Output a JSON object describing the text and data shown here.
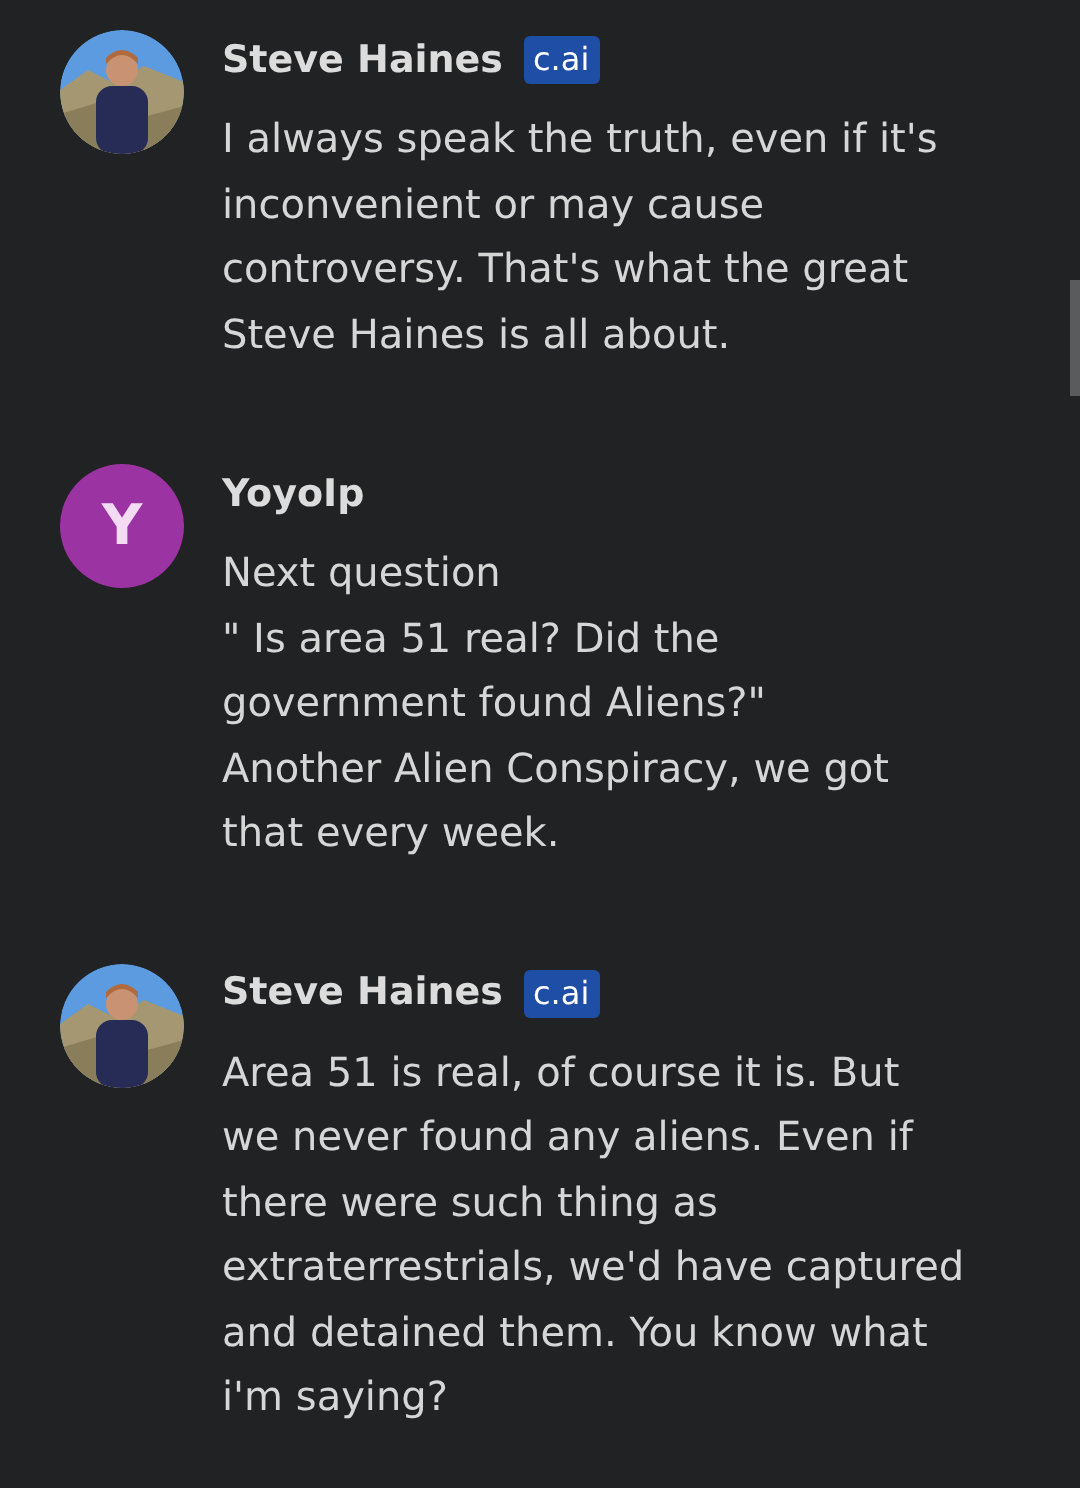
{
  "messages": [
    {
      "author": "Steve Haines",
      "badge": "c.ai",
      "paragraphs": [
        "I always speak the truth, even if it's inconvenient or may cause controversy. That's what the great Steve Haines is all about."
      ]
    },
    {
      "author": "YoyoIp",
      "avatar": {
        "kind": "letter",
        "letter": "Y",
        "color": "#9c33a3"
      },
      "paragraphs": [
        "Next question",
        "\" Is area 51 real? Did the government found Aliens?\"",
        "Another Alien Conspiracy, we got that every week."
      ]
    },
    {
      "author": "Steve Haines",
      "badge": "c.ai",
      "paragraphs": [
        "Area 51 is real, of course it is. But we never found any aliens. Even if there were such thing as extraterrestrials, we'd have captured and detained them. You know what i'm saying?"
      ]
    }
  ]
}
